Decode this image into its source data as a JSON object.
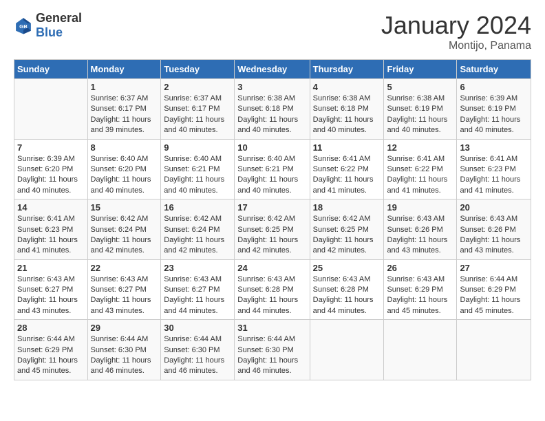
{
  "header": {
    "logo_general": "General",
    "logo_blue": "Blue",
    "title": "January 2024",
    "subtitle": "Montijo, Panama"
  },
  "calendar": {
    "columns": [
      "Sunday",
      "Monday",
      "Tuesday",
      "Wednesday",
      "Thursday",
      "Friday",
      "Saturday"
    ],
    "weeks": [
      [
        {
          "day": "",
          "sunrise": "",
          "sunset": "",
          "daylight": ""
        },
        {
          "day": "1",
          "sunrise": "Sunrise: 6:37 AM",
          "sunset": "Sunset: 6:17 PM",
          "daylight": "Daylight: 11 hours and 39 minutes."
        },
        {
          "day": "2",
          "sunrise": "Sunrise: 6:37 AM",
          "sunset": "Sunset: 6:17 PM",
          "daylight": "Daylight: 11 hours and 40 minutes."
        },
        {
          "day": "3",
          "sunrise": "Sunrise: 6:38 AM",
          "sunset": "Sunset: 6:18 PM",
          "daylight": "Daylight: 11 hours and 40 minutes."
        },
        {
          "day": "4",
          "sunrise": "Sunrise: 6:38 AM",
          "sunset": "Sunset: 6:18 PM",
          "daylight": "Daylight: 11 hours and 40 minutes."
        },
        {
          "day": "5",
          "sunrise": "Sunrise: 6:38 AM",
          "sunset": "Sunset: 6:19 PM",
          "daylight": "Daylight: 11 hours and 40 minutes."
        },
        {
          "day": "6",
          "sunrise": "Sunrise: 6:39 AM",
          "sunset": "Sunset: 6:19 PM",
          "daylight": "Daylight: 11 hours and 40 minutes."
        }
      ],
      [
        {
          "day": "7",
          "sunrise": "Sunrise: 6:39 AM",
          "sunset": "Sunset: 6:20 PM",
          "daylight": "Daylight: 11 hours and 40 minutes."
        },
        {
          "day": "8",
          "sunrise": "Sunrise: 6:40 AM",
          "sunset": "Sunset: 6:20 PM",
          "daylight": "Daylight: 11 hours and 40 minutes."
        },
        {
          "day": "9",
          "sunrise": "Sunrise: 6:40 AM",
          "sunset": "Sunset: 6:21 PM",
          "daylight": "Daylight: 11 hours and 40 minutes."
        },
        {
          "day": "10",
          "sunrise": "Sunrise: 6:40 AM",
          "sunset": "Sunset: 6:21 PM",
          "daylight": "Daylight: 11 hours and 40 minutes."
        },
        {
          "day": "11",
          "sunrise": "Sunrise: 6:41 AM",
          "sunset": "Sunset: 6:22 PM",
          "daylight": "Daylight: 11 hours and 41 minutes."
        },
        {
          "day": "12",
          "sunrise": "Sunrise: 6:41 AM",
          "sunset": "Sunset: 6:22 PM",
          "daylight": "Daylight: 11 hours and 41 minutes."
        },
        {
          "day": "13",
          "sunrise": "Sunrise: 6:41 AM",
          "sunset": "Sunset: 6:23 PM",
          "daylight": "Daylight: 11 hours and 41 minutes."
        }
      ],
      [
        {
          "day": "14",
          "sunrise": "Sunrise: 6:41 AM",
          "sunset": "Sunset: 6:23 PM",
          "daylight": "Daylight: 11 hours and 41 minutes."
        },
        {
          "day": "15",
          "sunrise": "Sunrise: 6:42 AM",
          "sunset": "Sunset: 6:24 PM",
          "daylight": "Daylight: 11 hours and 42 minutes."
        },
        {
          "day": "16",
          "sunrise": "Sunrise: 6:42 AM",
          "sunset": "Sunset: 6:24 PM",
          "daylight": "Daylight: 11 hours and 42 minutes."
        },
        {
          "day": "17",
          "sunrise": "Sunrise: 6:42 AM",
          "sunset": "Sunset: 6:25 PM",
          "daylight": "Daylight: 11 hours and 42 minutes."
        },
        {
          "day": "18",
          "sunrise": "Sunrise: 6:42 AM",
          "sunset": "Sunset: 6:25 PM",
          "daylight": "Daylight: 11 hours and 42 minutes."
        },
        {
          "day": "19",
          "sunrise": "Sunrise: 6:43 AM",
          "sunset": "Sunset: 6:26 PM",
          "daylight": "Daylight: 11 hours and 43 minutes."
        },
        {
          "day": "20",
          "sunrise": "Sunrise: 6:43 AM",
          "sunset": "Sunset: 6:26 PM",
          "daylight": "Daylight: 11 hours and 43 minutes."
        }
      ],
      [
        {
          "day": "21",
          "sunrise": "Sunrise: 6:43 AM",
          "sunset": "Sunset: 6:27 PM",
          "daylight": "Daylight: 11 hours and 43 minutes."
        },
        {
          "day": "22",
          "sunrise": "Sunrise: 6:43 AM",
          "sunset": "Sunset: 6:27 PM",
          "daylight": "Daylight: 11 hours and 43 minutes."
        },
        {
          "day": "23",
          "sunrise": "Sunrise: 6:43 AM",
          "sunset": "Sunset: 6:27 PM",
          "daylight": "Daylight: 11 hours and 44 minutes."
        },
        {
          "day": "24",
          "sunrise": "Sunrise: 6:43 AM",
          "sunset": "Sunset: 6:28 PM",
          "daylight": "Daylight: 11 hours and 44 minutes."
        },
        {
          "day": "25",
          "sunrise": "Sunrise: 6:43 AM",
          "sunset": "Sunset: 6:28 PM",
          "daylight": "Daylight: 11 hours and 44 minutes."
        },
        {
          "day": "26",
          "sunrise": "Sunrise: 6:43 AM",
          "sunset": "Sunset: 6:29 PM",
          "daylight": "Daylight: 11 hours and 45 minutes."
        },
        {
          "day": "27",
          "sunrise": "Sunrise: 6:44 AM",
          "sunset": "Sunset: 6:29 PM",
          "daylight": "Daylight: 11 hours and 45 minutes."
        }
      ],
      [
        {
          "day": "28",
          "sunrise": "Sunrise: 6:44 AM",
          "sunset": "Sunset: 6:29 PM",
          "daylight": "Daylight: 11 hours and 45 minutes."
        },
        {
          "day": "29",
          "sunrise": "Sunrise: 6:44 AM",
          "sunset": "Sunset: 6:30 PM",
          "daylight": "Daylight: 11 hours and 46 minutes."
        },
        {
          "day": "30",
          "sunrise": "Sunrise: 6:44 AM",
          "sunset": "Sunset: 6:30 PM",
          "daylight": "Daylight: 11 hours and 46 minutes."
        },
        {
          "day": "31",
          "sunrise": "Sunrise: 6:44 AM",
          "sunset": "Sunset: 6:30 PM",
          "daylight": "Daylight: 11 hours and 46 minutes."
        },
        {
          "day": "",
          "sunrise": "",
          "sunset": "",
          "daylight": ""
        },
        {
          "day": "",
          "sunrise": "",
          "sunset": "",
          "daylight": ""
        },
        {
          "day": "",
          "sunrise": "",
          "sunset": "",
          "daylight": ""
        }
      ]
    ]
  }
}
